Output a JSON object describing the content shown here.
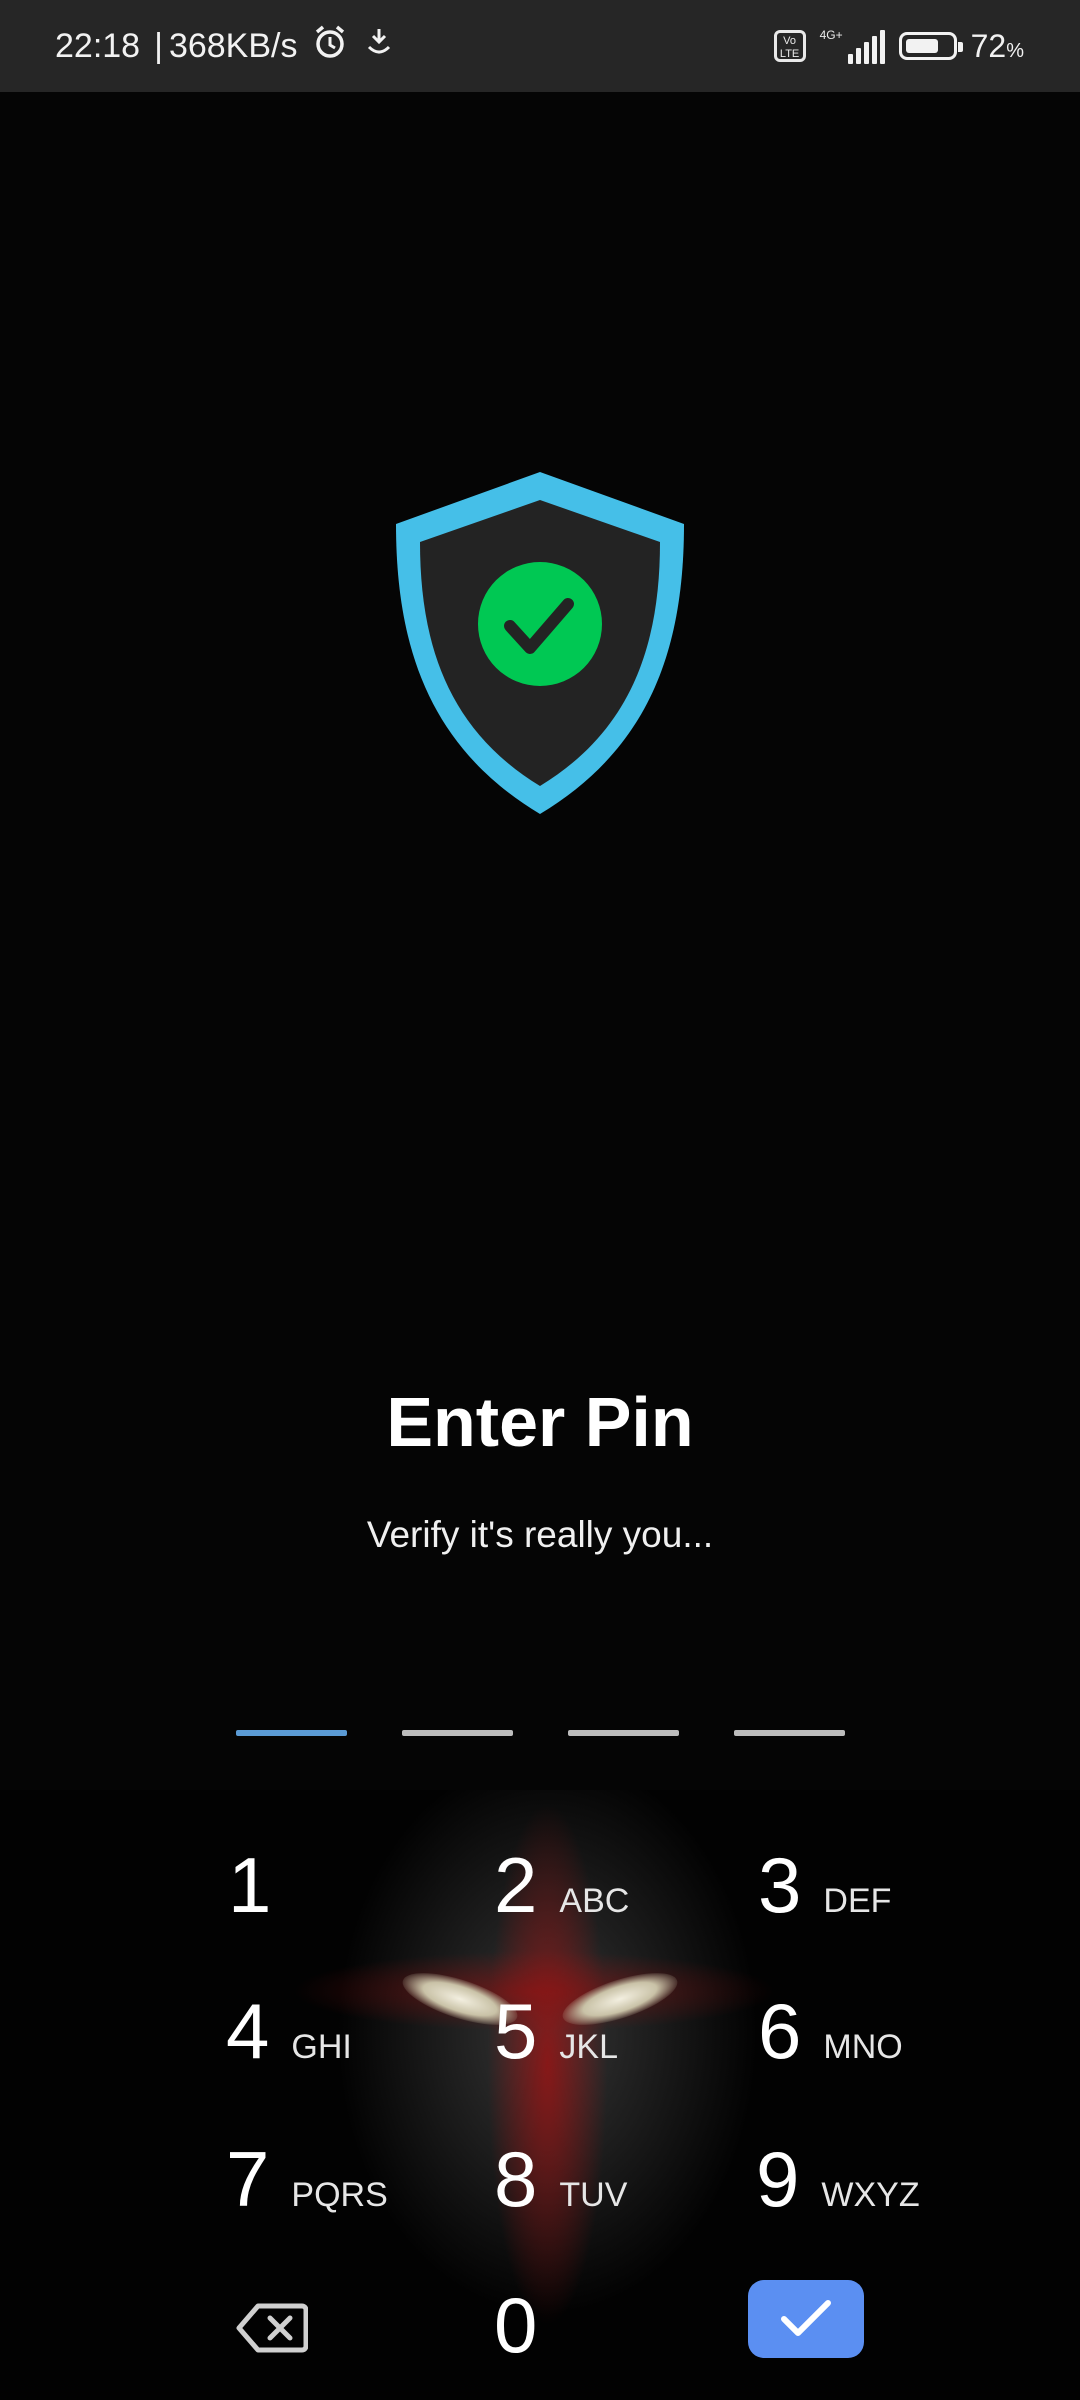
{
  "status_bar": {
    "time": "22:18",
    "separator": "|",
    "speed": "368KB/s",
    "volte": "Vo LTE",
    "network": "4G+",
    "battery_percent": "72",
    "percent_sign": "%",
    "battery_level": 0.72,
    "icons": [
      "alarm-icon",
      "download-icon",
      "volte-icon",
      "signal-icon",
      "battery-icon"
    ]
  },
  "hero": {
    "icon": "shield-check-icon",
    "shield_color": "#45bfe8",
    "check_color": "#00c853"
  },
  "title": "Enter Pin",
  "subtitle": "Verify it's really you...",
  "pin": {
    "length": 4,
    "entered": 0,
    "active_color": "#5b9bd5"
  },
  "keypad": {
    "keys": [
      {
        "digit": "1",
        "letters": ""
      },
      {
        "digit": "2",
        "letters": "ABC"
      },
      {
        "digit": "3",
        "letters": "DEF"
      },
      {
        "digit": "4",
        "letters": "GHI"
      },
      {
        "digit": "5",
        "letters": "JKL"
      },
      {
        "digit": "6",
        "letters": "MNO"
      },
      {
        "digit": "7",
        "letters": "PQRS"
      },
      {
        "digit": "8",
        "letters": "TUV"
      },
      {
        "digit": "9",
        "letters": "WXYZ"
      },
      {
        "digit": "0",
        "letters": ""
      }
    ],
    "backspace_icon": "backspace-icon",
    "confirm_icon": "check-icon",
    "confirm_color": "#5b8ff2"
  }
}
